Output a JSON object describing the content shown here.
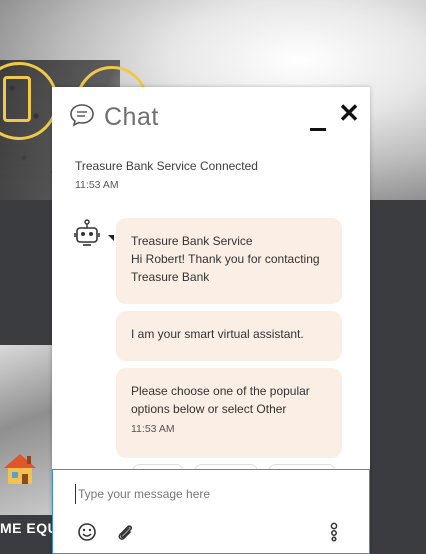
{
  "background": {
    "caption_partial": "ME EQU",
    "accent_color": "#f0c94a"
  },
  "chat": {
    "title": "Chat",
    "icons": {
      "header": "chat-bubble-icon",
      "minimize": "minimize-icon",
      "close": "close-icon",
      "bot": "robot-icon",
      "emoji": "smiley-icon",
      "attach": "paperclip-icon",
      "voice": "voice-assistant-icon"
    },
    "system_message": {
      "text": "Treasure Bank Service Connected",
      "time": "11:53 AM"
    },
    "messages": [
      {
        "sender": "Treasure Bank Service",
        "text": "Hi Robert! Thank you for contacting Treasure Bank"
      },
      {
        "text": "I am your smart virtual assistant."
      },
      {
        "text": "Please choose one of the popular options below or select Other",
        "time": "11:53 AM"
      }
    ],
    "input": {
      "placeholder": "Type your message here",
      "value": ""
    },
    "colors": {
      "bubble": "#fbeee5",
      "input_border": "#3d8fe0"
    }
  }
}
